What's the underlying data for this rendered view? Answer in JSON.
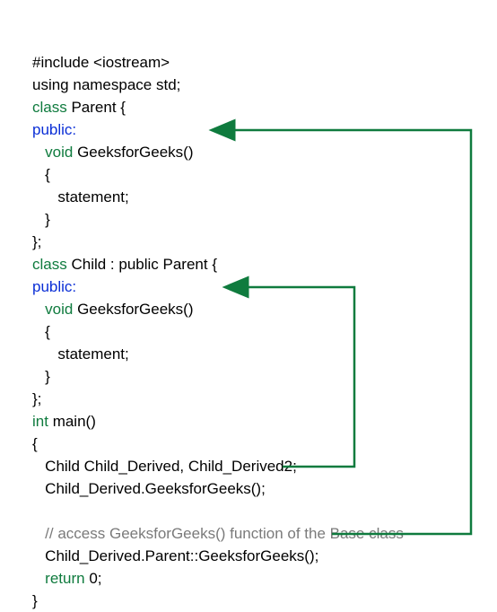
{
  "code": {
    "include_line": "#include <iostream>",
    "using_line": "using namespace std;",
    "class_kw1": "class",
    "parent_decl": " Parent {",
    "public_kw": "public:",
    "void_kw": "void",
    "parent_method": " GeeksforGeeks()",
    "brace_open": "{",
    "stmt_line": "statement;",
    "brace_close": "}",
    "class_end": "};",
    "class_kw2": "class",
    "child_decl": " Child : public Parent {",
    "child_method": " GeeksforGeeks()",
    "int_kw": "int",
    "main_decl": " main()",
    "main_body1": "Child Child_Derived, Child_Derived2;",
    "main_body2": "Child_Derived.GeeksforGeeks();",
    "comment_line": "// access GeeksforGeeks() function of the Base class",
    "main_body3": " Child_Derived.Parent::GeeksforGeeks();",
    "return_kw": "return",
    "return_val": " 0;"
  },
  "arrows": {
    "color": "#0f7b3e"
  }
}
